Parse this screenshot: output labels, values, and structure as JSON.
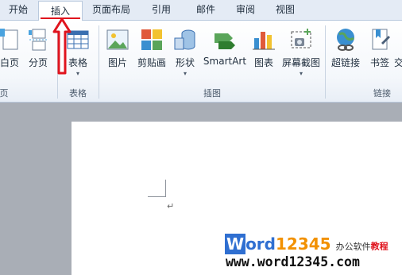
{
  "tabs": [
    {
      "label": "开始"
    },
    {
      "label": "插入",
      "active": true
    },
    {
      "label": "页面布局"
    },
    {
      "label": "引用"
    },
    {
      "label": "邮件"
    },
    {
      "label": "审阅"
    },
    {
      "label": "视图"
    }
  ],
  "ribbon": {
    "pages_group": {
      "label": "页",
      "commands": [
        {
          "label": "白页",
          "icon": "blank-page-icon"
        },
        {
          "label": "分页",
          "icon": "page-break-icon"
        }
      ]
    },
    "table_group": {
      "label": "表格",
      "commands": [
        {
          "label": "表格",
          "icon": "table-icon",
          "has_dropdown": true
        }
      ]
    },
    "illustrations_group": {
      "label": "插图",
      "commands": [
        {
          "label": "图片",
          "icon": "picture-icon"
        },
        {
          "label": "剪贴画",
          "icon": "clipart-icon"
        },
        {
          "label": "形状",
          "icon": "shapes-icon",
          "has_dropdown": true
        },
        {
          "label": "SmartArt",
          "icon": "smartart-icon"
        },
        {
          "label": "图表",
          "icon": "chart-icon"
        },
        {
          "label": "屏幕截图",
          "icon": "screenshot-icon",
          "has_dropdown": true
        }
      ]
    },
    "links_group": {
      "label": "链接",
      "commands": [
        {
          "label": "超链接",
          "icon": "hyperlink-icon"
        },
        {
          "label": "书签",
          "icon": "bookmark-icon"
        },
        {
          "label": "交",
          "icon": "cross-reference-icon"
        }
      ]
    }
  },
  "document": {
    "paragraph_mark": "↵"
  },
  "watermark": {
    "logo_w": "W",
    "logo_ord": "ord",
    "logo_num": "12345",
    "tagline_a": "办公软件",
    "tagline_b": "教程",
    "url": "www.word12345.com"
  },
  "colors": {
    "accent_red": "#e0141e",
    "logo_blue": "#2f6fd1",
    "logo_orange": "#f29100"
  }
}
